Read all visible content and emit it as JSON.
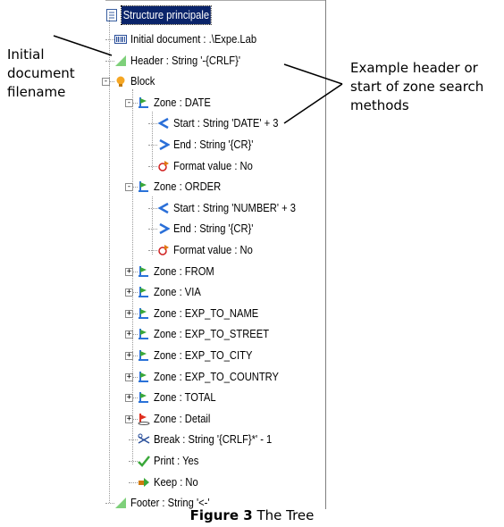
{
  "tree": {
    "root": {
      "label": "Structure principale",
      "selected": true,
      "icon": "document-structure-icon"
    },
    "items": [
      {
        "label": "Initial document : .\\Expe.Lab",
        "icon": "barcode-document-icon",
        "level": 1
      },
      {
        "label": "Header : String '-{CRLF}'",
        "icon": "header-flag-icon",
        "level": 1
      },
      {
        "label": "Block",
        "icon": "block-bulb-icon",
        "level": 1,
        "expander": "-"
      },
      {
        "label": "Zone : DATE",
        "icon": "zone-icon",
        "level": 2,
        "expander": "-"
      },
      {
        "label": "Start : String 'DATE' + 3",
        "icon": "start-arrow-icon",
        "level": 3
      },
      {
        "label": "End : String '{CR}'",
        "icon": "end-arrow-icon",
        "level": 3
      },
      {
        "label": "Format value : No",
        "icon": "format-value-icon",
        "level": 3
      },
      {
        "label": "Zone : ORDER",
        "icon": "zone-icon",
        "level": 2,
        "expander": "-"
      },
      {
        "label": "Start : String 'NUMBER' + 3",
        "icon": "start-arrow-icon",
        "level": 3
      },
      {
        "label": "End : String '{CR}'",
        "icon": "end-arrow-icon",
        "level": 3
      },
      {
        "label": "Format value : No",
        "icon": "format-value-icon",
        "level": 3
      },
      {
        "label": "Zone : FROM",
        "icon": "zone-icon",
        "level": 2,
        "expander": "+"
      },
      {
        "label": "Zone : VIA",
        "icon": "zone-icon",
        "level": 2,
        "expander": "+"
      },
      {
        "label": "Zone : EXP_TO_NAME",
        "icon": "zone-icon",
        "level": 2,
        "expander": "+"
      },
      {
        "label": "Zone : EXP_TO_STREET",
        "icon": "zone-icon",
        "level": 2,
        "expander": "+"
      },
      {
        "label": "Zone : EXP_TO_CITY",
        "icon": "zone-icon",
        "level": 2,
        "expander": "+"
      },
      {
        "label": "Zone : EXP_TO_COUNTRY",
        "icon": "zone-icon",
        "level": 2,
        "expander": "+"
      },
      {
        "label": "Zone : TOTAL",
        "icon": "zone-icon",
        "level": 2,
        "expander": "+"
      },
      {
        "label": "Zone : Detail",
        "icon": "zone-detail-icon",
        "level": 2,
        "expander": "+"
      },
      {
        "label": "Break : String '{CRLF}*' - 1",
        "icon": "break-scissors-icon",
        "level": 2
      },
      {
        "label": "Print : Yes",
        "icon": "print-check-icon",
        "level": 2
      },
      {
        "label": "Keep : No",
        "icon": "keep-arrow-icon",
        "level": 2
      },
      {
        "label": "Footer : String '<-'",
        "icon": "footer-flag-icon",
        "level": 1
      }
    ]
  },
  "callouts": {
    "left": [
      "Initial",
      "document",
      "filename"
    ],
    "right": [
      "Example header or",
      "start of zone search",
      "methods"
    ]
  },
  "caption": {
    "bold": "Figure 3",
    "text": " The Tree"
  },
  "colors": {
    "selection": "#0a246a",
    "zone_blue": "#2a72d8",
    "zone_green": "#3aa83a",
    "detail_red": "#e03020"
  }
}
